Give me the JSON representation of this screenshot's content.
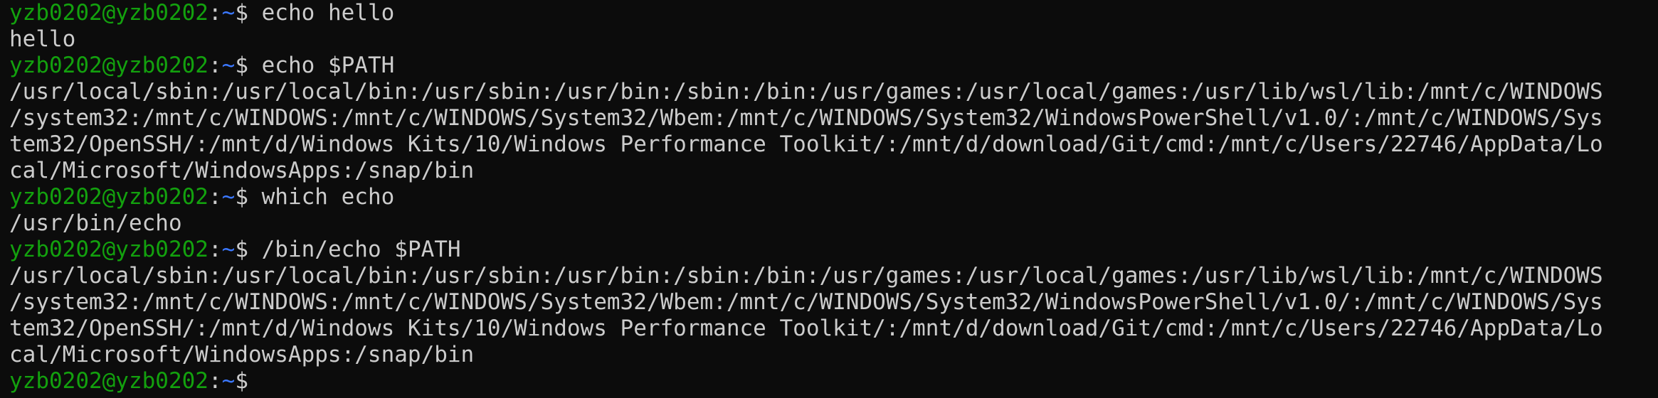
{
  "terminal": {
    "prompt": {
      "user_host": "yzb0202@yzb0202",
      "sep": ":",
      "path": "~",
      "symbol": "$ "
    },
    "lines": [
      {
        "type": "prompt",
        "command": "echo hello"
      },
      {
        "type": "output",
        "text": "hello"
      },
      {
        "type": "prompt",
        "command": "echo $PATH"
      },
      {
        "type": "output",
        "text": "/usr/local/sbin:/usr/local/bin:/usr/sbin:/usr/bin:/sbin:/bin:/usr/games:/usr/local/games:/usr/lib/wsl/lib:/mnt/c/WINDOWS"
      },
      {
        "type": "output",
        "text": "/system32:/mnt/c/WINDOWS:/mnt/c/WINDOWS/System32/Wbem:/mnt/c/WINDOWS/System32/WindowsPowerShell/v1.0/:/mnt/c/WINDOWS/Sys"
      },
      {
        "type": "output",
        "text": "tem32/OpenSSH/:/mnt/d/Windows Kits/10/Windows Performance Toolkit/:/mnt/d/download/Git/cmd:/mnt/c/Users/22746/AppData/Lo"
      },
      {
        "type": "output",
        "text": "cal/Microsoft/WindowsApps:/snap/bin"
      },
      {
        "type": "prompt",
        "command": "which echo"
      },
      {
        "type": "output",
        "text": "/usr/bin/echo"
      },
      {
        "type": "prompt",
        "command": "/bin/echo $PATH"
      },
      {
        "type": "output",
        "text": "/usr/local/sbin:/usr/local/bin:/usr/sbin:/usr/bin:/sbin:/bin:/usr/games:/usr/local/games:/usr/lib/wsl/lib:/mnt/c/WINDOWS"
      },
      {
        "type": "output",
        "text": "/system32:/mnt/c/WINDOWS:/mnt/c/WINDOWS/System32/Wbem:/mnt/c/WINDOWS/System32/WindowsPowerShell/v1.0/:/mnt/c/WINDOWS/Sys"
      },
      {
        "type": "output",
        "text": "tem32/OpenSSH/:/mnt/d/Windows Kits/10/Windows Performance Toolkit/:/mnt/d/download/Git/cmd:/mnt/c/Users/22746/AppData/Lo"
      },
      {
        "type": "output",
        "text": "cal/Microsoft/WindowsApps:/snap/bin"
      },
      {
        "type": "prompt",
        "command": ""
      }
    ]
  },
  "colors": {
    "background": "#0c0c0c",
    "foreground": "#cccccc",
    "user_host": "#13a10e",
    "path": "#3b78ff"
  }
}
